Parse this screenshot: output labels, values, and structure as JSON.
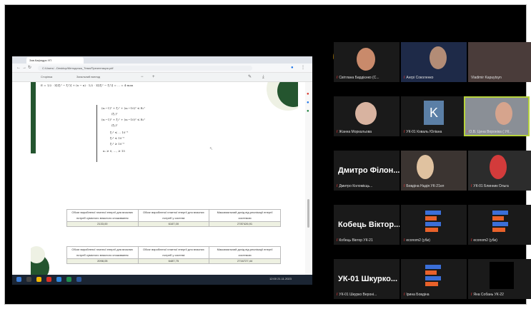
{
  "browser": {
    "tab_title": "Зав.Кафедри УП",
    "url": "C:/Users/...Desktop/Методичка_Тема/Презентация.pdf",
    "pdf_page": "Сторінка",
    "pdf_of": "Загальний вигляд"
  },
  "document": {
    "formula_top": "E = 1/2 · Σ[(ξᵢ² − ξᵢ²)] + (x − n) · 1/2 · Σ[(ξᵢ² − ξᵢ²)] = ... = 4·max",
    "equations": [
      "(x₁−1)² + ξ₁² + (x₂−10)² ≤ R₁²",
      "(ξ₁)²",
      "(x₁−1)² + ξ₁² + (x₂−10)² ≤ R₂²",
      "(ξ₂)²",
      "ξ₁² ≤ ... 10⁻⁸",
      "ξ₂² ≤ 10⁻⁸",
      "ξ₁² ≥ 10⁻⁸",
      "x₁ ≥ 0, ..., ≥ 15"
    ],
    "table1": {
      "headers": [
        "Обсяг виробленої платної енергії для власних потреб сумісного власного споживання",
        "Обсяг виробленої платної енергії для власних потреб у системі",
        "Максимальний дохід від реалізації енергії системою"
      ],
      "values": [
        "2133,00",
        "6167,00",
        "2787426,91"
      ]
    },
    "table2": {
      "headers": [
        "Обсяг виробленої платної енергії для власних потреб сумісного власного споживання",
        "Обсяг виробленої платної енергії для власних потреб у системі",
        "Максимальний дохід від реалізації енергії системою"
      ],
      "values": [
        "2098,05",
        "6487,75",
        "2716727,44"
      ]
    }
  },
  "taskbar": {
    "time": "12:00",
    "date": "21.11.2023"
  },
  "participants": [
    {
      "name": "Світлана Бардієнко (С...",
      "type": "video"
    },
    {
      "name": "Ангрі Соколенко",
      "type": "video"
    },
    {
      "name": "Vladimir Kapuytsyn",
      "type": "video"
    },
    {
      "name": "Жанна Моркальова",
      "type": "video"
    },
    {
      "name": "УК-01 Коваль Юлiана",
      "type": "letter",
      "letter": "K"
    },
    {
      "name": "О.В. Цена Вороніка ( УК...",
      "type": "video",
      "active": true
    },
    {
      "name": "Дмитро Коломієць...",
      "type": "name",
      "display": "Дмитро Філон..."
    },
    {
      "name": "Бовдіна Надія УК-21ел",
      "type": "video"
    },
    {
      "name": "УК-01 Блинник Ольга",
      "type": "video"
    },
    {
      "name": "Кобець Віктор УК-21",
      "type": "name",
      "display": "Кобець Віктор..."
    },
    {
      "name": "econom2 (уби)",
      "type": "logo"
    },
    {
      "name": "econom2 (уби)",
      "type": "logo"
    },
    {
      "name": "УК-01 Шкурко Веронi...",
      "type": "name",
      "display": "УК-01 Шкурко..."
    },
    {
      "name": "Ірина Бовдіна",
      "type": "logo"
    },
    {
      "name": "Яна Собань УК-22",
      "type": "dark"
    }
  ]
}
